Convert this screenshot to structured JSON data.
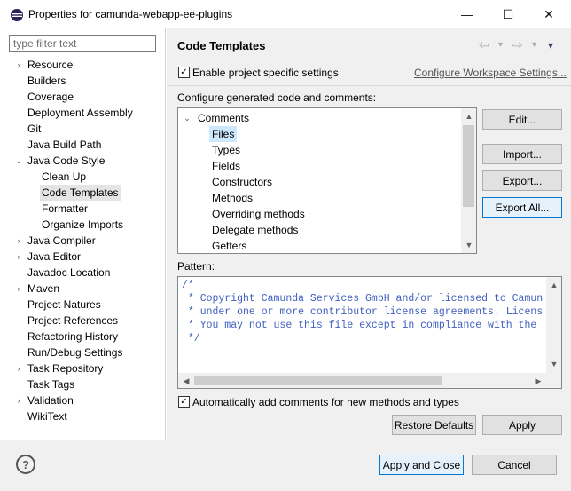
{
  "window": {
    "title": "Properties for camunda-webapp-ee-plugins",
    "minimize_glyph": "—",
    "maximize_glyph": "☐",
    "close_glyph": "✕"
  },
  "sidebar": {
    "filter_placeholder": "type filter text",
    "items": [
      {
        "label": "Resource",
        "arrow": "›"
      },
      {
        "label": "Builders",
        "arrow": ""
      },
      {
        "label": "Coverage",
        "arrow": ""
      },
      {
        "label": "Deployment Assembly",
        "arrow": ""
      },
      {
        "label": "Git",
        "arrow": ""
      },
      {
        "label": "Java Build Path",
        "arrow": ""
      },
      {
        "label": "Java Code Style",
        "arrow": "⌄"
      },
      {
        "label": "Clean Up",
        "arrow": ""
      },
      {
        "label": "Code Templates",
        "arrow": ""
      },
      {
        "label": "Formatter",
        "arrow": ""
      },
      {
        "label": "Organize Imports",
        "arrow": ""
      },
      {
        "label": "Java Compiler",
        "arrow": "›"
      },
      {
        "label": "Java Editor",
        "arrow": "›"
      },
      {
        "label": "Javadoc Location",
        "arrow": ""
      },
      {
        "label": "Maven",
        "arrow": "›"
      },
      {
        "label": "Project Natures",
        "arrow": ""
      },
      {
        "label": "Project References",
        "arrow": ""
      },
      {
        "label": "Refactoring History",
        "arrow": ""
      },
      {
        "label": "Run/Debug Settings",
        "arrow": ""
      },
      {
        "label": "Task Repository",
        "arrow": "›"
      },
      {
        "label": "Task Tags",
        "arrow": ""
      },
      {
        "label": "Validation",
        "arrow": "›"
      },
      {
        "label": "WikiText",
        "arrow": ""
      }
    ]
  },
  "page": {
    "title": "Code Templates",
    "nav": {
      "back": "⇦",
      "forward": "⇨",
      "dropdown": "▾",
      "menu": "▾"
    },
    "enable_specific_label": "Enable project specific settings",
    "enable_specific_checked": "✓",
    "configure_workspace_link": "Configure Workspace Settings...",
    "configure_label": "Configure generated code and comments:",
    "tree": {
      "root_label": "Comments",
      "root_arrow": "⌄",
      "children": [
        "Files",
        "Types",
        "Fields",
        "Constructors",
        "Methods",
        "Overriding methods",
        "Delegate methods",
        "Getters"
      ]
    },
    "buttons": {
      "edit": "Edit...",
      "import": "Import...",
      "export": "Export...",
      "export_all": "Export All..."
    },
    "pattern_label": "Pattern:",
    "pattern_lines": [
      "/*",
      " * Copyright Camunda Services GmbH and/or licensed to Camun",
      " * under one or more contributor license agreements. Licens",
      " * You may not use this file except in compliance with the",
      " */"
    ],
    "auto_comments_label": "Automatically add comments for new methods and types",
    "auto_comments_checked": "✓",
    "restore_defaults": "Restore Defaults",
    "apply": "Apply"
  },
  "footer": {
    "help_glyph": "?",
    "apply_close": "Apply and Close",
    "cancel": "Cancel"
  },
  "scroll": {
    "up": "▲",
    "down": "▼",
    "left": "◀",
    "right": "▶"
  }
}
